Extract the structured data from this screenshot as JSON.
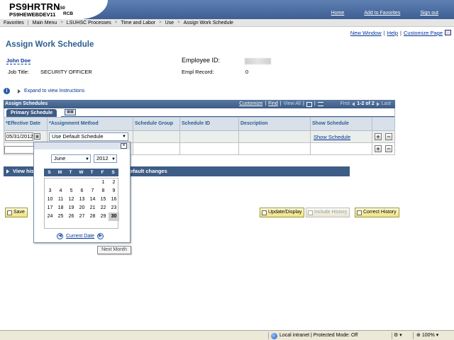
{
  "header": {
    "app_name": "PS9HRTRN",
    "version": "8.50",
    "server": "PS9HEWEBDEV11",
    "user_code": "RCB",
    "links": [
      "Home",
      "Add to Favorites",
      "Sign out"
    ]
  },
  "breadcrumb": {
    "items": [
      "Favorites",
      "Main Menu",
      "LSUHSC Processes",
      "Time and Labor",
      "Use",
      "Assign Work Schedule"
    ]
  },
  "toolbar": {
    "new_window": "New Window",
    "help": "Help",
    "customize_page": "Customize Page"
  },
  "page": {
    "title": "Assign Work Schedule",
    "employee_name": "John Doe",
    "job_title_label": "Job Title:",
    "job_title_value": "SECURITY OFFICER",
    "employee_id_label": "Employee ID:",
    "empl_record_label": "Empl Record:",
    "empl_record_value": "0",
    "expand_instructions": "Expand to view Instructions"
  },
  "grid": {
    "title": "Assign Schedules",
    "customize": "Customize",
    "find": "Find",
    "view_all": "View All",
    "first": "First",
    "range": "1-2 of 2",
    "last": "Last",
    "tab_label": "Primary Schedule",
    "columns": [
      "*Effective Date",
      "*Assignment Method",
      "Schedule Group",
      "Schedule ID",
      "Description",
      "Show Schedule"
    ],
    "row1": {
      "effective_date": "05/31/2012",
      "assignment_method": "Use Default Schedule",
      "show_schedule": "Show Schedule"
    }
  },
  "calendar": {
    "month": "June",
    "year": "2012",
    "days_of_week": [
      "S",
      "M",
      "T",
      "W",
      "T",
      "F",
      "S"
    ],
    "weeks": [
      [
        "",
        "",
        "",
        "",
        "",
        "1",
        "2"
      ],
      [
        "3",
        "4",
        "5",
        "6",
        "7",
        "8",
        "9"
      ],
      [
        "10",
        "11",
        "12",
        "13",
        "14",
        "15",
        "16"
      ],
      [
        "17",
        "18",
        "19",
        "20",
        "21",
        "22",
        "23"
      ],
      [
        "24",
        "25",
        "26",
        "27",
        "28",
        "29",
        "30"
      ]
    ],
    "selected_day": "30",
    "current_date": "Current Date",
    "tooltip": "Next Month"
  },
  "history_bar": {
    "text_left": "View hist",
    "text_right": "g default changes"
  },
  "buttons": {
    "save": "Save",
    "update_display": "Update/Display",
    "include_history": "Include History",
    "correct_history": "Correct History"
  },
  "statusbar": {
    "zone": "Local intranet | Protected Mode: Off",
    "zoom": "100%"
  },
  "colors": {
    "header_band": "#4f72a6",
    "grid_header": "#3d5c86",
    "title_blue": "#2e5d8f",
    "link_blue": "#003399",
    "button_yellow": "#f2e27a"
  }
}
